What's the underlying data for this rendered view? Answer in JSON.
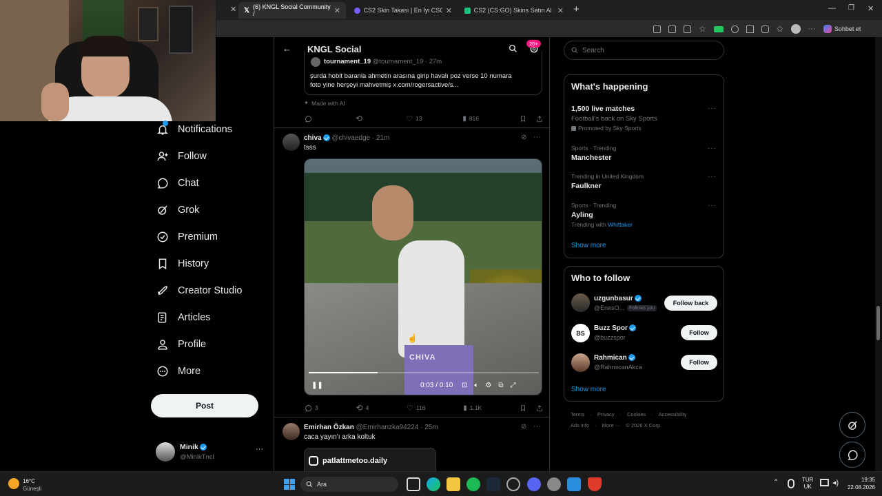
{
  "browser": {
    "tabs": [
      {
        "title": "(6) KNGL Social Community / ",
        "active": true
      },
      {
        "title": "CS2 Skin Takası | En İyi CSGO Bot",
        "active": false
      },
      {
        "title": "CS2 (CS:GO) Skins Satın Al | Skins",
        "active": false
      }
    ],
    "profile_label": "Sohbet et"
  },
  "nav": {
    "items": [
      {
        "label": "Notifications",
        "icon": "bell-icon"
      },
      {
        "label": "Follow",
        "icon": "add-user-icon"
      },
      {
        "label": "Chat",
        "icon": "chat-icon"
      },
      {
        "label": "Grok",
        "icon": "grok-icon"
      },
      {
        "label": "Premium",
        "icon": "premium-icon"
      },
      {
        "label": "History",
        "icon": "bookmark-icon"
      },
      {
        "label": "Creator Studio",
        "icon": "rocket-icon"
      },
      {
        "label": "Articles",
        "icon": "article-icon"
      },
      {
        "label": "Profile",
        "icon": "person-icon"
      },
      {
        "label": "More",
        "icon": "more-circle-icon"
      }
    ],
    "post_label": "Post",
    "account": {
      "name": "Minik",
      "handle": "@MinikTncl"
    }
  },
  "feed": {
    "header_title": "KNGL Social",
    "badge": "20+",
    "quoted": {
      "author": "tournament_19",
      "handle": "@tournament_19 · 27m",
      "text_line1": "şurda hobit baranla ahmetin arasına girip havalı poz verse 10 numara",
      "text_line2": "foto yine herşeyi mahvetmiş x.com/rogersactive/s..."
    },
    "made_with_ai": "Made with AI",
    "post1_actions": {
      "replies": "",
      "reposts": "",
      "likes": "13",
      "views": "816"
    },
    "post2": {
      "author": "chiva",
      "handle": "@chivaedge · 21m",
      "text": "tsss",
      "video_time": "0:03 / 0:10",
      "video_progress": 0.3,
      "watermark": "CHIVA",
      "actions": {
        "replies": "3",
        "reposts": "4",
        "likes": "116",
        "views": "1.1K"
      }
    },
    "post3": {
      "author": "Emirhan Özkan",
      "handle": "@Emirhanzka94224 · 25m",
      "text": "caca yayın'ı arka koltuk",
      "embed_label": "patlattmetoo.daily"
    }
  },
  "sidebar": {
    "search_placeholder": "Search",
    "whats_happening_title": "What's happening",
    "trends": [
      {
        "meta": "",
        "title": "1,500 live matches",
        "sub": "Football's back on Sky Sports",
        "promo": "Promoted by Sky Sports"
      },
      {
        "meta": "Sports · Trending",
        "title": "Manchester",
        "sub": ""
      },
      {
        "meta": "Trending in United Kingdom",
        "title": "Faulkner",
        "sub": ""
      },
      {
        "meta": "Sports · Trending",
        "title": "Ayling",
        "sub": "Trending with",
        "link": "Whittaker"
      }
    ],
    "show_more": "Show more",
    "who_to_follow_title": "Who to follow",
    "suggestions": [
      {
        "name": "uzgunbasur",
        "handle": "@EnesO...",
        "follows_you": "Follows you",
        "button": "Follow back"
      },
      {
        "name": "Buzz Spor",
        "handle": "@buzzspor",
        "button": "Follow"
      },
      {
        "name": "Rahmican",
        "handle": "@RahmicanAkca",
        "button": "Follow"
      }
    ],
    "show_more2": "Show more",
    "footer_line1": [
      "Terms",
      "Privacy",
      "Cookies",
      "Accessibility"
    ],
    "footer_line2": [
      "Ads info",
      "More ···",
      "© 2026 X Corp."
    ]
  },
  "taskbar": {
    "weather_temp": "16°C",
    "weather_desc": "Güneşli",
    "search_label": "Ara",
    "lang_top": "TUR",
    "lang_bottom": "UK",
    "time": "19:35",
    "date": "22.08.2026"
  }
}
